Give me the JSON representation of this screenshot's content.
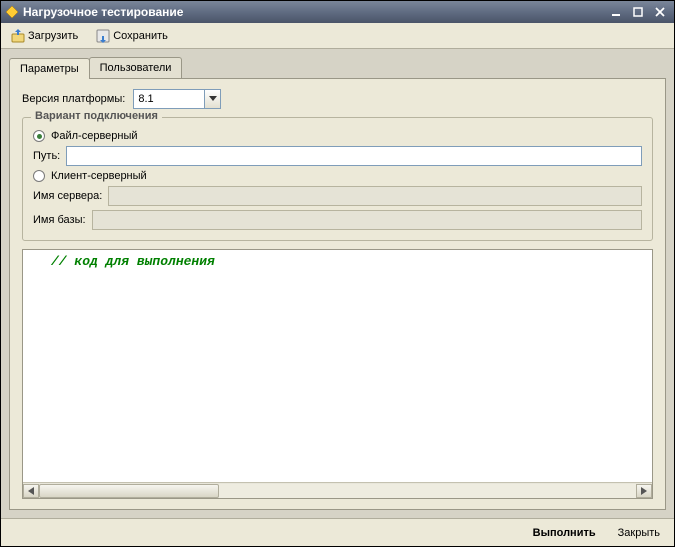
{
  "window": {
    "title": "Нагрузочное тестирование"
  },
  "toolbar": {
    "load": "Загрузить",
    "save": "Сохранить"
  },
  "tabs": {
    "params": "Параметры",
    "users": "Пользователи"
  },
  "params": {
    "platform_label": "Версия платформы:",
    "platform_value": "8.1",
    "connection_legend": "Вариант подключения",
    "file_server": "Файл-серверный",
    "client_server": "Клиент-серверный",
    "path_label": "Путь:",
    "path_value": "",
    "server_label": "Имя сервера:",
    "server_value": "",
    "base_label": "Имя базы:",
    "base_value": ""
  },
  "code": {
    "content": "// код для выполнения"
  },
  "footer": {
    "execute": "Выполнить",
    "close": "Закрыть"
  }
}
